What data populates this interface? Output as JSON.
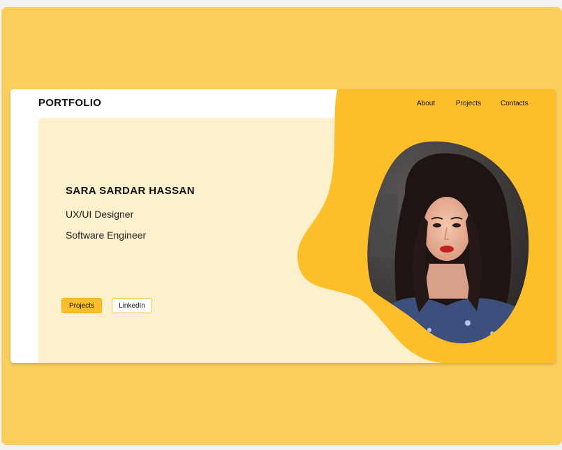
{
  "brand": {
    "logo": "PORTFOLIO"
  },
  "nav": {
    "items": [
      {
        "label": "About"
      },
      {
        "label": "Projects"
      },
      {
        "label": "Contacts"
      }
    ]
  },
  "hero": {
    "name": "SARA SARDAR HASSAN",
    "roles": [
      "UX/UI Designer",
      "Software Engineer"
    ],
    "buttons": {
      "projects": "Projects",
      "linkedin": "LinkedIn"
    }
  },
  "colors": {
    "page_background": "#fcce5e",
    "accent": "#fcbf2a",
    "cream": "#fdf0cc",
    "card": "#ffffff"
  },
  "icons": {
    "portrait": "profile-photo"
  }
}
